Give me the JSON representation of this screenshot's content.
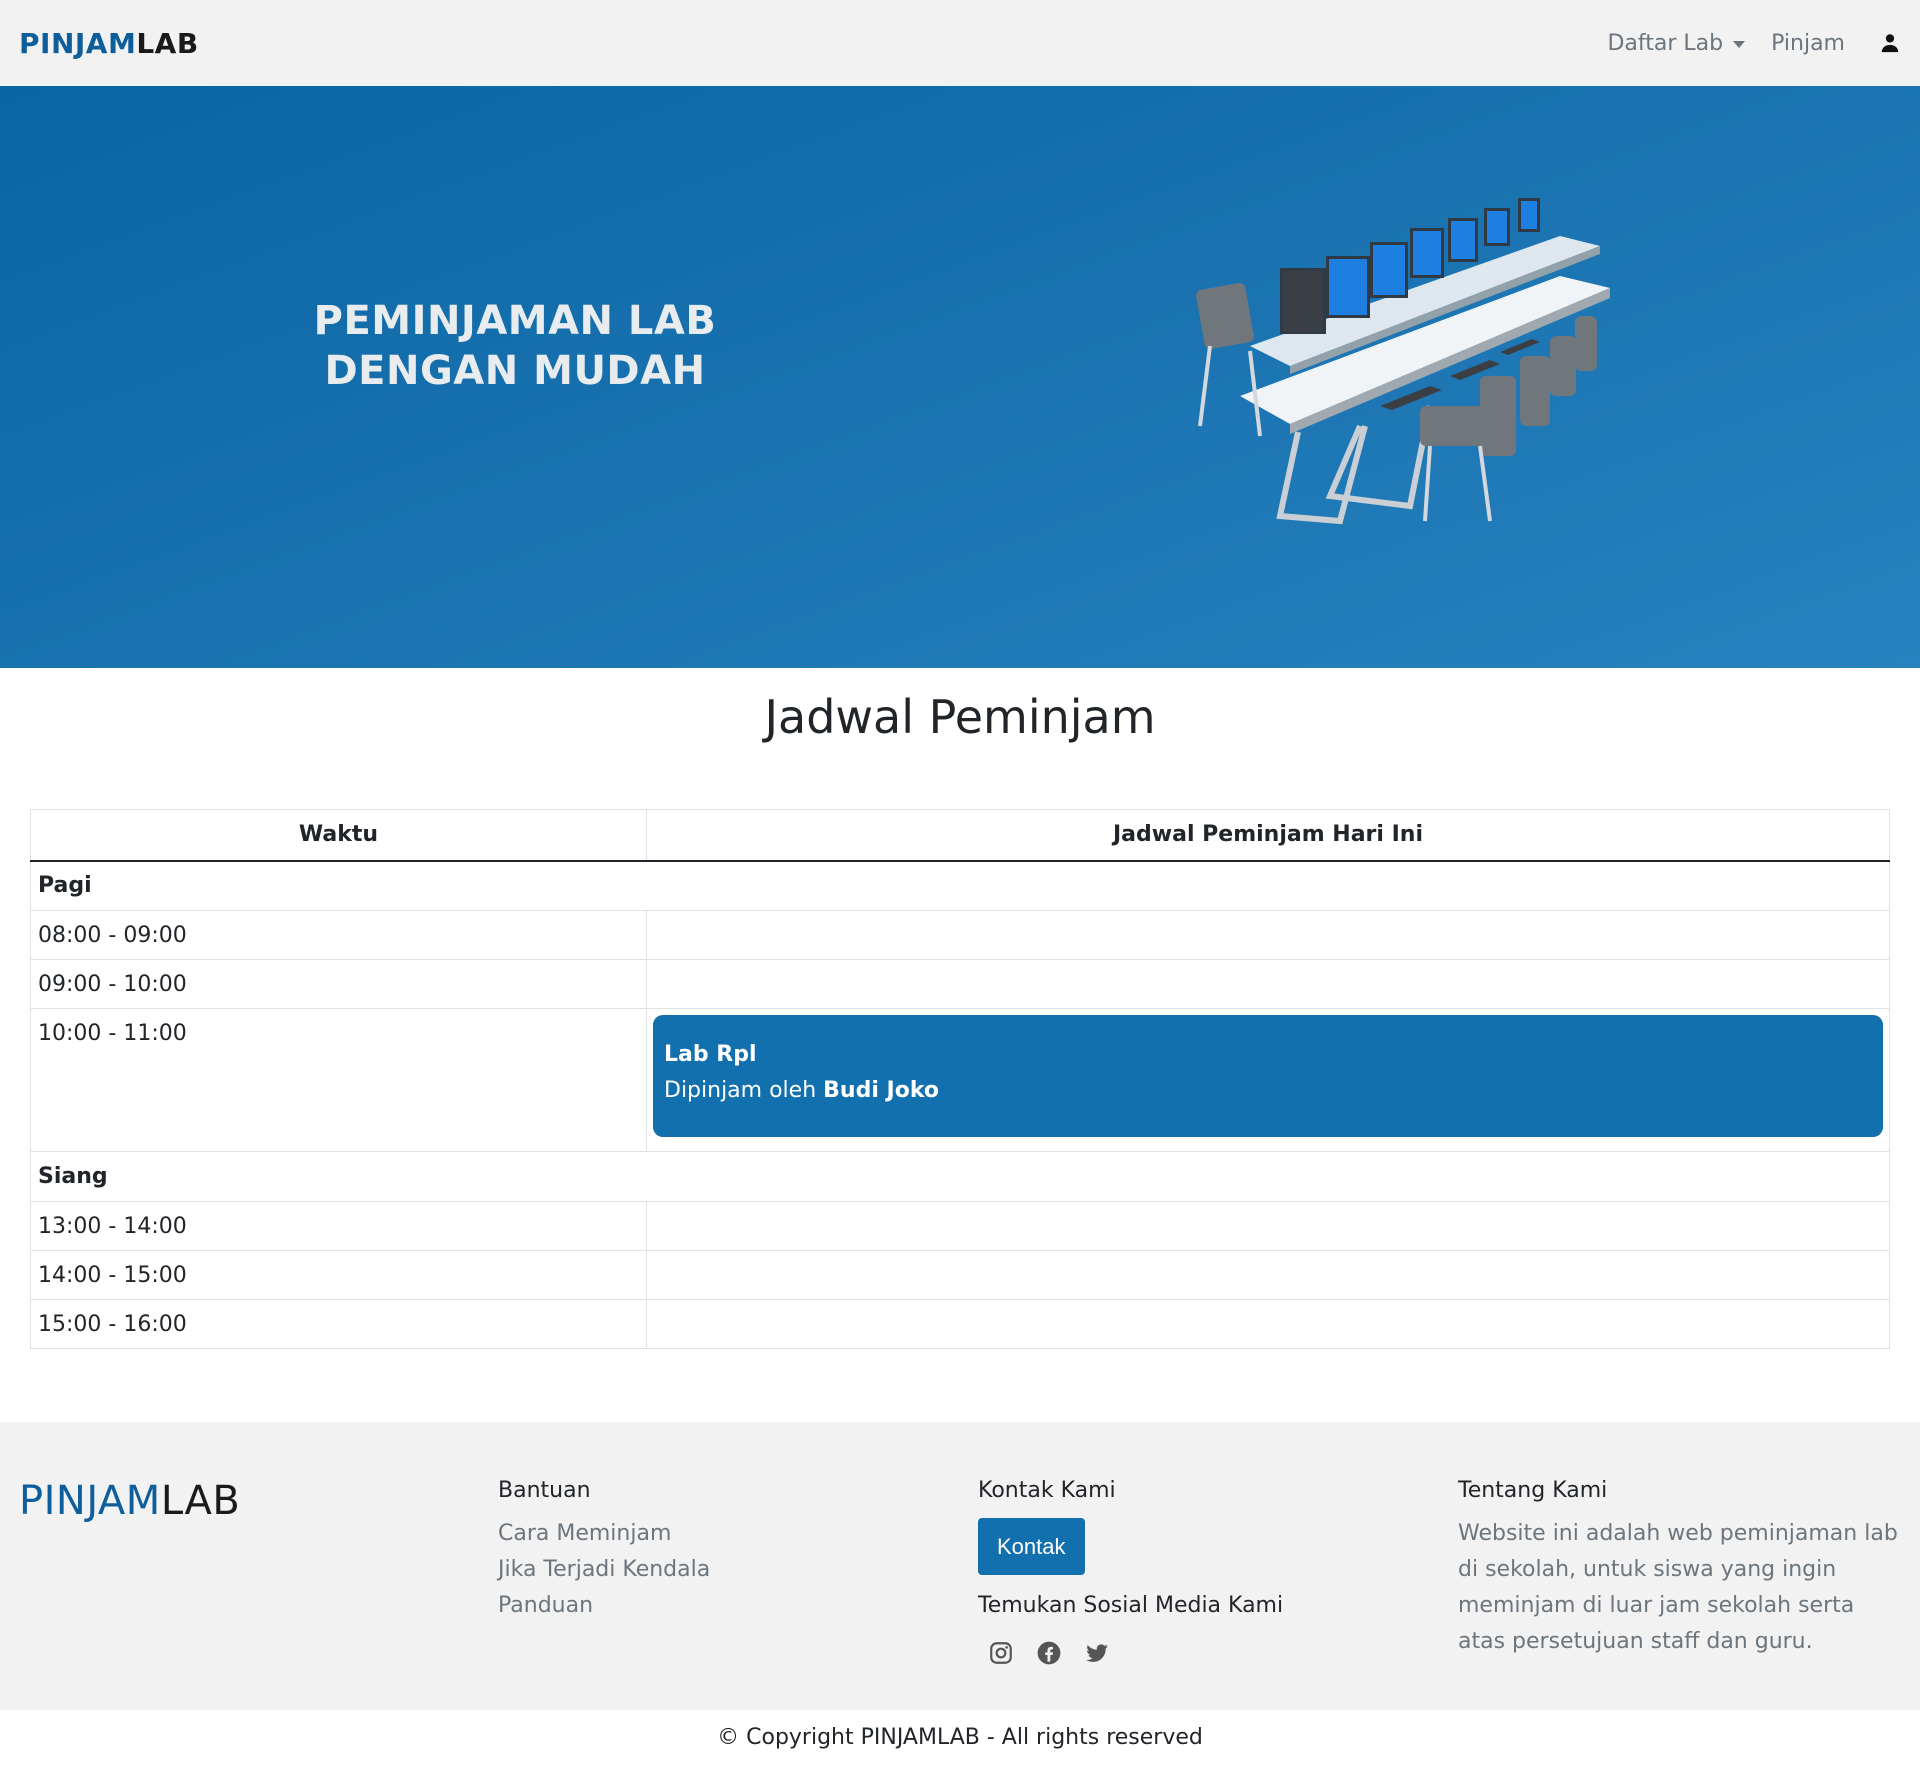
{
  "navbar": {
    "brand_part1": "PINJAM",
    "brand_part2": "LAB",
    "daftar_lab": "Daftar Lab",
    "pinjam": "Pinjam",
    "user_icon": "user-icon"
  },
  "hero": {
    "title_line1": "PEMINJAMAN LAB",
    "title_line2": "DENGAN MUDAH",
    "illustration": "computer-lab-illustration"
  },
  "schedule": {
    "title": "Jadwal Peminjam",
    "headers": [
      "Waktu",
      "Jadwal Peminjam Hari Ini"
    ],
    "sessions": [
      {
        "name": "Pagi",
        "slots": [
          {
            "time": "08:00 - 09:00"
          },
          {
            "time": "09:00 - 10:00"
          },
          {
            "time": "10:00 - 11:00",
            "booking": {
              "lab": "Lab Rpl",
              "prefix": "Dipinjam oleh ",
              "borrower": "Budi Joko"
            }
          }
        ]
      },
      {
        "name": "Siang",
        "slots": [
          {
            "time": "13:00 - 14:00"
          },
          {
            "time": "14:00 - 15:00"
          },
          {
            "time": "15:00 - 16:00"
          }
        ]
      }
    ]
  },
  "footer": {
    "brand_part1": "PINJAM",
    "brand_part2": "LAB",
    "bantuan": {
      "title": "Bantuan",
      "links": [
        "Cara Meminjam",
        "Jika Terjadi Kendala",
        "Panduan"
      ]
    },
    "kontak": {
      "title": "Kontak Kami",
      "button": "Kontak",
      "social_title": "Temukan Sosial Media Kami",
      "social_icons": [
        "instagram-icon",
        "facebook-icon",
        "twitter-icon"
      ]
    },
    "tentang": {
      "title": "Tentang Kami",
      "text": "Website ini adalah web peminjaman lab di sekolah, untuk siswa yang ingin meminjam di luar jam sekolah serta atas persetujuan staff dan guru."
    },
    "copyright": "© Copyright PINJAMLAB - All rights reserved"
  },
  "colors": {
    "brand_blue": "#0f5e9c",
    "accent_blue": "#1370af",
    "navbar_bg": "#f2f2f2",
    "muted_text": "#6c757d"
  }
}
